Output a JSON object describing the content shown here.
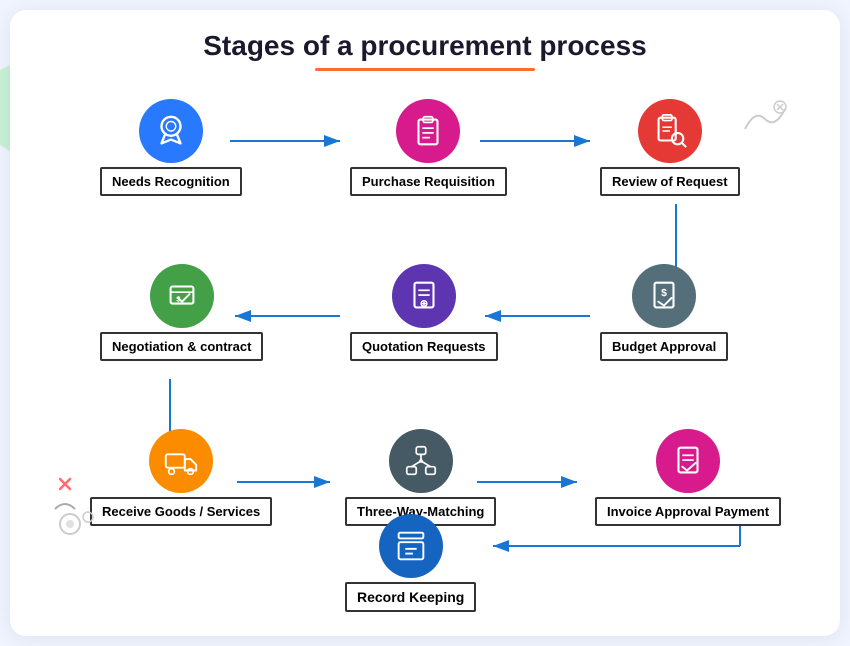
{
  "page": {
    "title": "Stages of a procurement process"
  },
  "nodes": {
    "needs_recognition": {
      "label": "Needs Recognition",
      "icon_color": "blue",
      "icon_symbol": "🏆"
    },
    "purchase_requisition": {
      "label": "Purchase Requisition",
      "icon_color": "magenta",
      "icon_symbol": "📋"
    },
    "review_of_request": {
      "label": "Review of Request",
      "icon_color": "red",
      "icon_symbol": "🔍"
    },
    "negotiation": {
      "label": "Negotiation & contract",
      "icon_color": "green",
      "icon_symbol": "💼"
    },
    "quotation_requests": {
      "label": "Quotation Requests",
      "icon_color": "purple",
      "icon_symbol": "📄"
    },
    "budget_approval": {
      "label": "Budget Approval",
      "icon_color": "gray",
      "icon_symbol": "💰"
    },
    "receive_goods": {
      "label": "Receive Goods / Services",
      "icon_color": "orange",
      "icon_symbol": "🚚"
    },
    "three_way_matching": {
      "label": "Three-Way-Matching",
      "icon_color": "dark_gray",
      "icon_symbol": "🔗"
    },
    "invoice_approval": {
      "label": "Invoice Approval Payment",
      "icon_color": "pink",
      "icon_symbol": "✅"
    },
    "record_keeping": {
      "label": "Record Keeping",
      "icon_color": "dark_blue",
      "icon_symbol": "🗄"
    }
  },
  "colors": {
    "blue": "#2979ff",
    "magenta": "#d81b8c",
    "red": "#e53935",
    "green": "#43a047",
    "purple": "#5e35b1",
    "gray": "#546e7a",
    "orange": "#fb8c00",
    "dark_gray": "#455a64",
    "pink": "#d81b8c",
    "dark_blue": "#1565c0",
    "arrow": "#1976d2"
  }
}
